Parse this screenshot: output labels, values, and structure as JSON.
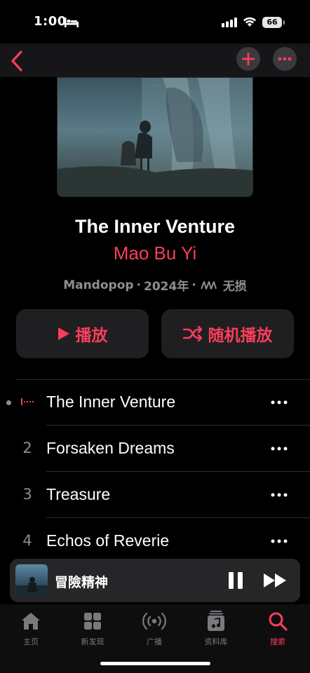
{
  "status_bar": {
    "time": "1:00",
    "battery": "66"
  },
  "album": {
    "title": "The Inner Venture",
    "artist": "Mao Bu Yi",
    "genre": "Mandopop",
    "separator1": "·",
    "year": "2024年",
    "separator2": "·",
    "quality": "无损"
  },
  "actions": {
    "play_label": "播放",
    "shuffle_label": "随机播放"
  },
  "tracks": [
    {
      "number": "",
      "title": "The Inner Venture",
      "playing": true
    },
    {
      "number": "2",
      "title": "Forsaken Dreams"
    },
    {
      "number": "3",
      "title": "Treasure"
    },
    {
      "number": "4",
      "title": "Echos of Reverie"
    }
  ],
  "mini_player": {
    "title": "冒險精神"
  },
  "tab_bar": {
    "items": [
      {
        "label": "主页",
        "icon": "home-icon"
      },
      {
        "label": "新发现",
        "icon": "grid-icon"
      },
      {
        "label": "广播",
        "icon": "radio-icon"
      },
      {
        "label": "资料库",
        "icon": "library-icon"
      },
      {
        "label": "搜索",
        "icon": "search-icon",
        "active": true
      }
    ]
  },
  "colors": {
    "accent": "#fa3d5a",
    "secondary_text": "#8e8e93",
    "background": "#000000"
  }
}
